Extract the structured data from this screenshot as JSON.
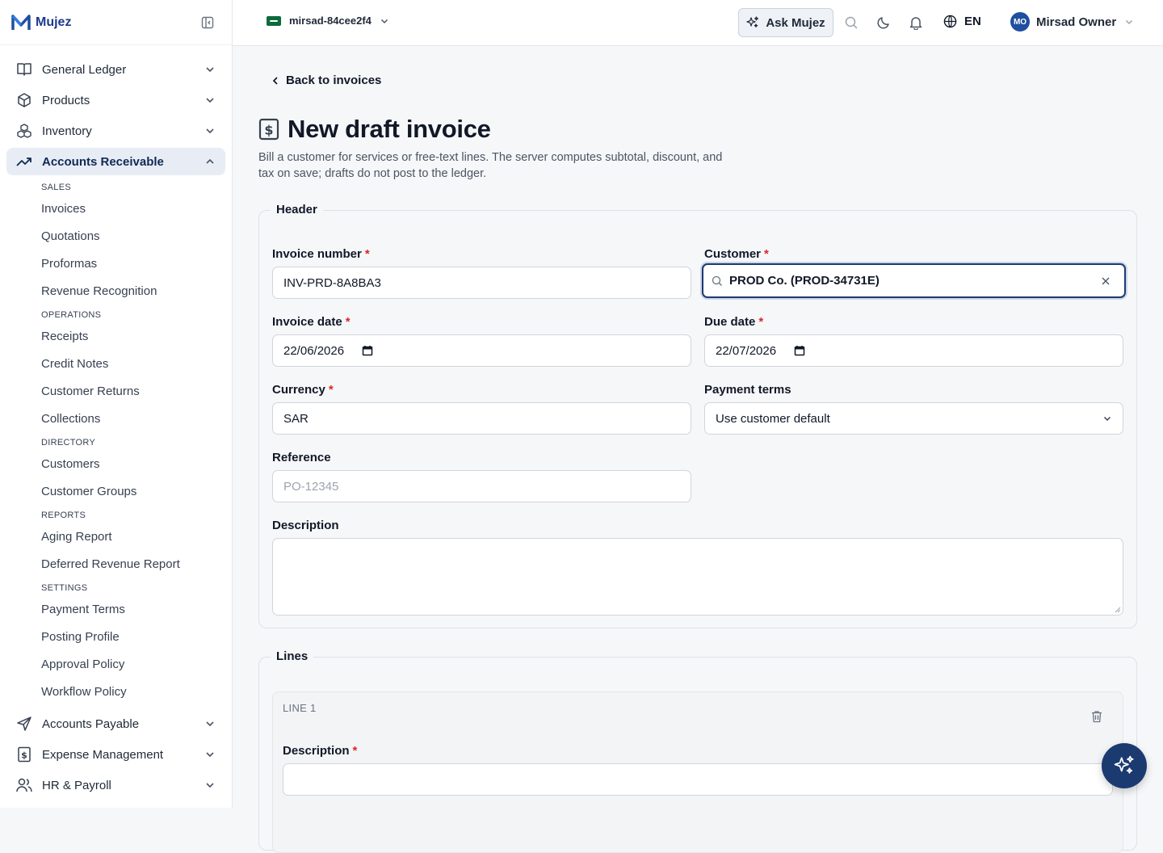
{
  "app": {
    "name": "Mujez"
  },
  "sidebar": {
    "top_items": [
      {
        "label": "General Ledger",
        "icon": "book-icon"
      },
      {
        "label": "Products",
        "icon": "box-icon"
      },
      {
        "label": "Inventory",
        "icon": "boxes-icon"
      },
      {
        "label": "Accounts Receivable",
        "icon": "trending-up-icon",
        "active": true
      }
    ],
    "sections": {
      "sales": "SALES",
      "operations": "OPERATIONS",
      "directory": "DIRECTORY",
      "reports": "REPORTS",
      "settings": "SETTINGS"
    },
    "sub_items": {
      "invoices": "Invoices",
      "quotations": "Quotations",
      "proformas": "Proformas",
      "revenue_recognition": "Revenue Recognition",
      "receipts": "Receipts",
      "credit_notes": "Credit Notes",
      "customer_returns": "Customer Returns",
      "collections": "Collections",
      "customers": "Customers",
      "customer_groups": "Customer Groups",
      "aging_report": "Aging Report",
      "deferred_revenue_report": "Deferred Revenue Report",
      "payment_terms": "Payment Terms",
      "posting_profile": "Posting Profile",
      "approval_policy": "Approval Policy",
      "workflow_policy": "Workflow Policy"
    },
    "bottom_items": [
      {
        "label": "Accounts Payable",
        "icon": "send-icon"
      },
      {
        "label": "Expense Management",
        "icon": "receipt-icon"
      },
      {
        "label": "HR & Payroll",
        "icon": "users-icon"
      }
    ]
  },
  "topbar": {
    "tenant": "mirsad-84cee2f4",
    "ask_label": "Ask Mujez",
    "language": "EN",
    "user_initials": "MO",
    "user_name": "Mirsad Owner"
  },
  "page": {
    "back_label": "Back to invoices",
    "title": "New draft invoice",
    "subtitle": "Bill a customer for services or free-text lines. The server computes subtotal, discount, and tax on save; drafts do not post to the ledger."
  },
  "header_section": {
    "legend": "Header",
    "invoice_number": {
      "label": "Invoice number",
      "value": "INV-PRD-8A8BA3"
    },
    "customer": {
      "label": "Customer",
      "value": "PROD Co. (PROD-34731E)"
    },
    "invoice_date": {
      "label": "Invoice date",
      "value": "22/06/2026"
    },
    "due_date": {
      "label": "Due date",
      "value": "22/07/2026"
    },
    "currency": {
      "label": "Currency",
      "value": "SAR"
    },
    "payment_terms": {
      "label": "Payment terms",
      "value": "Use customer default"
    },
    "reference": {
      "label": "Reference",
      "placeholder": "PO-12345"
    },
    "description": {
      "label": "Description",
      "value": ""
    }
  },
  "lines_section": {
    "legend": "Lines",
    "line_label": "LINE 1",
    "description_label": "Description"
  },
  "required_mark": "*"
}
